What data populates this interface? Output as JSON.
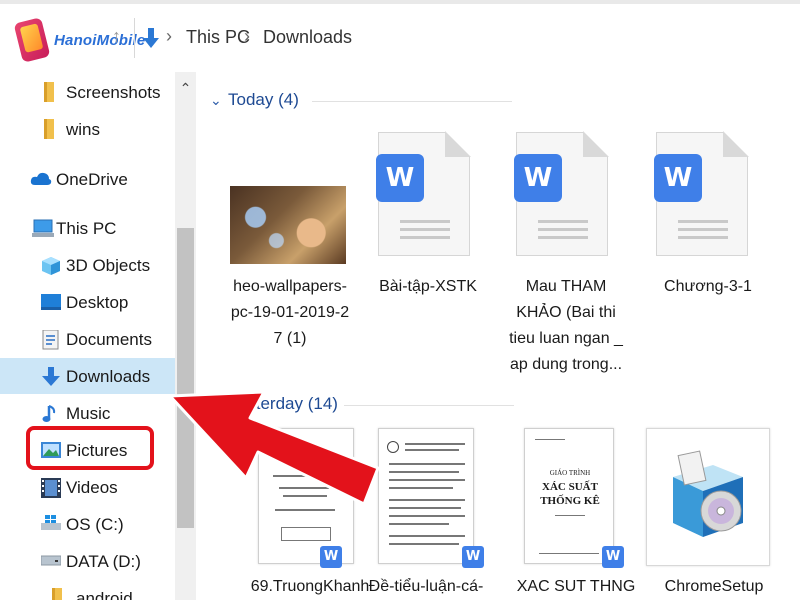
{
  "brand": {
    "logo_text": "HanoiMobile"
  },
  "address": {
    "crumbs": [
      "This PC",
      "Downloads"
    ]
  },
  "sidebar": {
    "items": [
      {
        "label": "Screenshots",
        "icon": "folder-icon"
      },
      {
        "label": "wins",
        "icon": "folder-icon"
      },
      {
        "label": "OneDrive",
        "icon": "cloud-icon"
      },
      {
        "label": "This PC",
        "icon": "computer-icon"
      },
      {
        "label": "3D Objects",
        "icon": "cube-icon"
      },
      {
        "label": "Desktop",
        "icon": "desktop-icon"
      },
      {
        "label": "Documents",
        "icon": "document-icon"
      },
      {
        "label": "Downloads",
        "icon": "download-icon",
        "selected": true
      },
      {
        "label": "Music",
        "icon": "music-icon"
      },
      {
        "label": "Pictures",
        "icon": "pictures-icon"
      },
      {
        "label": "Videos",
        "icon": "videos-icon"
      },
      {
        "label": "OS (C:)",
        "icon": "windows-drive-icon"
      },
      {
        "label": "DATA (D:)",
        "icon": "drive-icon"
      },
      {
        "label": "android",
        "icon": "folder-icon"
      }
    ]
  },
  "groups": {
    "today": {
      "label": "Today (4)"
    },
    "yesterday": {
      "label": "Yesterday (14)"
    }
  },
  "files_today": [
    {
      "name": "heo-wallpapers-pc-19-01-2019-27 (1)",
      "lines": [
        "heo-wallpapers-",
        "pc-19-01-2019-2",
        "7 (1)"
      ],
      "type": "image"
    },
    {
      "name": "Bài-tập-XSTK",
      "lines": [
        "Bài-tập-XSTK"
      ],
      "type": "word"
    },
    {
      "name": "Mau THAM KHẢO (Bai thi tieu luan ngan _ ap dung trong...",
      "lines": [
        "Mau THAM",
        "KHẢO (Bai thi",
        "tieu luan ngan _",
        "ap dung trong..."
      ],
      "type": "word"
    },
    {
      "name": "Chương-3-1",
      "lines": [
        "Chương-3-1"
      ],
      "type": "word"
    }
  ],
  "files_yesterday": [
    {
      "lines": [
        "69.TruongKhanh"
      ],
      "type": "word-doc"
    },
    {
      "lines": [
        "Đề-tiểu-luận-cá-"
      ],
      "type": "word-doc"
    },
    {
      "lines": [
        "XAC SUT THNG"
      ],
      "type": "word-doc",
      "doc_title": [
        "GIÁO TRÌNH",
        "XÁC SUẤT",
        "THỐNG KÊ"
      ]
    },
    {
      "lines": [
        "ChromeSetup"
      ],
      "type": "installer"
    }
  ],
  "colors": {
    "accent": "#2b78d4",
    "highlight": "#e3121b",
    "selected_bg": "#cce6f7",
    "word_blue": "#3f7fe8"
  }
}
